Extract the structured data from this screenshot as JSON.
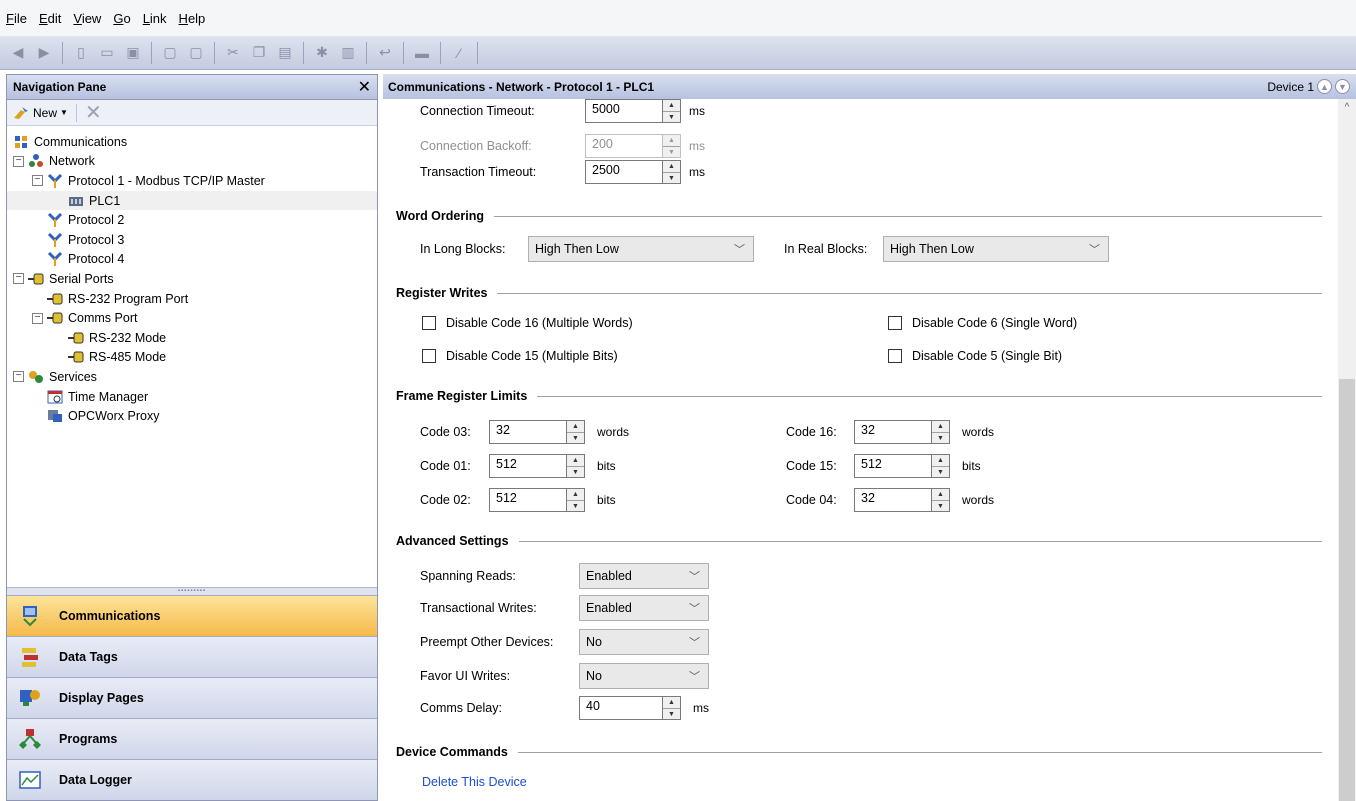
{
  "menu": [
    {
      "acc": "F",
      "rest": "ile"
    },
    {
      "acc": "E",
      "rest": "dit"
    },
    {
      "acc": "V",
      "rest": "iew"
    },
    {
      "acc": "G",
      "rest": "o"
    },
    {
      "acc": "L",
      "rest": "ink"
    },
    {
      "acc": "H",
      "rest": "elp"
    }
  ],
  "nav": {
    "title": "Navigation Pane",
    "new_label": "New",
    "tree": [
      "Communications",
      "Network",
      "Protocol 1 - Modbus TCP/IP Master",
      "PLC1",
      "Protocol 2",
      "Protocol 3",
      "Protocol 4",
      "Serial Ports",
      "RS-232 Program Port",
      "Comms Port",
      "RS-232 Mode",
      "RS-485 Mode",
      "Services",
      "Time Manager",
      "OPCWorx Proxy"
    ],
    "buttons": [
      "Communications",
      "Data Tags",
      "Display Pages",
      "Programs",
      "Data Logger"
    ]
  },
  "main": {
    "title": "Communications - Network - Protocol 1 - PLC1",
    "device": "Device 1",
    "conn_timeout": {
      "label": "Connection Timeout:",
      "value": "5000",
      "unit": "ms"
    },
    "conn_backoff": {
      "label": "Connection Backoff:",
      "value": "200",
      "unit": "ms"
    },
    "trans_timeout": {
      "label": "Transaction Timeout:",
      "value": "2500",
      "unit": "ms"
    },
    "word_ordering": {
      "title": "Word Ordering",
      "long_label": "In Long Blocks:",
      "long_value": "High Then Low",
      "real_label": "In Real Blocks:",
      "real_value": "High Then Low"
    },
    "register_writes": {
      "title": "Register Writes",
      "c16": "Disable Code 16 (Multiple Words)",
      "c15": "Disable Code 15 (Multiple Bits)",
      "c6": "Disable Code 6 (Single Word)",
      "c5": "Disable Code 5 (Single Bit)"
    },
    "frame_limits": {
      "title": "Frame Register Limits",
      "c03": {
        "label": "Code 03:",
        "value": "32",
        "unit": "words"
      },
      "c01": {
        "label": "Code 01:",
        "value": "512",
        "unit": "bits"
      },
      "c02": {
        "label": "Code 02:",
        "value": "512",
        "unit": "bits"
      },
      "c16": {
        "label": "Code 16:",
        "value": "32",
        "unit": "words"
      },
      "c15": {
        "label": "Code 15:",
        "value": "512",
        "unit": "bits"
      },
      "c04": {
        "label": "Code 04:",
        "value": "32",
        "unit": "words"
      }
    },
    "advanced": {
      "title": "Advanced Settings",
      "spanning": {
        "label": "Spanning Reads:",
        "value": "Enabled"
      },
      "transactional": {
        "label": "Transactional Writes:",
        "value": "Enabled"
      },
      "preempt": {
        "label": "Preempt Other Devices:",
        "value": "No"
      },
      "favor": {
        "label": "Favor UI Writes:",
        "value": "No"
      },
      "delay": {
        "label": "Comms Delay:",
        "value": "40",
        "unit": "ms"
      }
    },
    "device_commands": {
      "title": "Device Commands",
      "delete": "Delete This Device"
    }
  }
}
